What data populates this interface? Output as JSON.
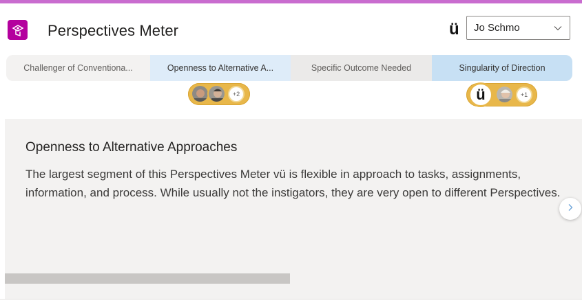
{
  "app": {
    "title": "Perspectives Meter",
    "brand_mark": "ü",
    "accent_color": "#c96ccf",
    "icon": "perspectives-app-icon",
    "icon_color": "#b4009e"
  },
  "user_select": {
    "value": "Jo Schmo",
    "icon": "chevron-down-icon"
  },
  "tabs": [
    {
      "label": "Challenger of Conventiona...",
      "selected": false
    },
    {
      "label": "Openness to Alternative A...",
      "selected": true
    },
    {
      "label": "Specific Outcome Needed",
      "selected": false
    },
    {
      "label": "Singularity of Direction",
      "selected": false
    }
  ],
  "avatar_groups": [
    {
      "count_label": "+2"
    },
    {
      "brand_mark": "ü",
      "count_label": "+1"
    }
  ],
  "detail": {
    "title": "Openness to Alternative Approaches",
    "body": "The largest segment of this Perspectives Meter vü is flexible in approach to tasks, assignments, information, and process. While usually not the instigators, they are very open to different Perspectives."
  },
  "next_button": {
    "icon": "chevron-right-icon"
  }
}
